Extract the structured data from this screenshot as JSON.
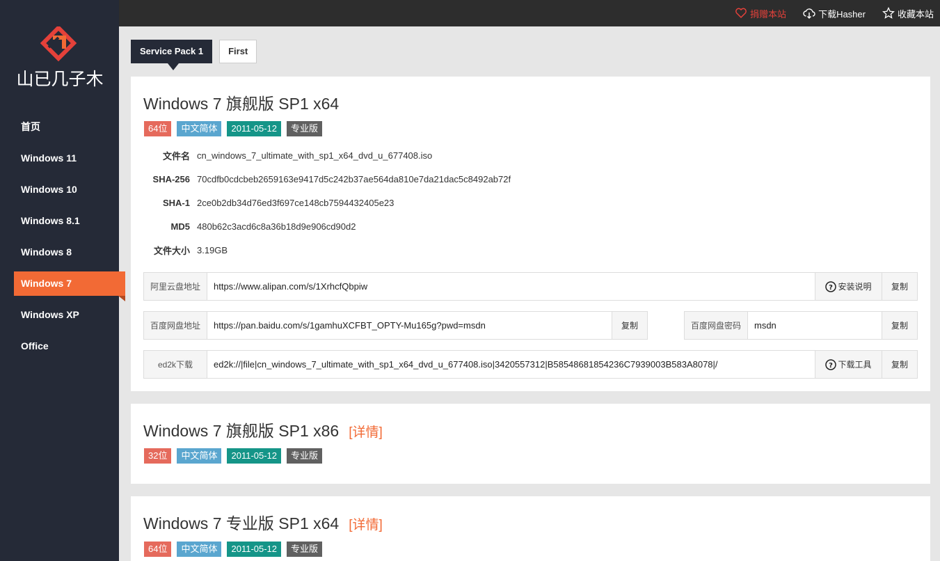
{
  "brand": {
    "logo_text": "山已几子木"
  },
  "nav": {
    "items": [
      {
        "label": "首页"
      },
      {
        "label": "Windows 11"
      },
      {
        "label": "Windows 10"
      },
      {
        "label": "Windows 8.1"
      },
      {
        "label": "Windows 8"
      },
      {
        "label": "Windows 7",
        "active": true
      },
      {
        "label": "Windows XP"
      },
      {
        "label": "Office"
      }
    ]
  },
  "topbar": {
    "donate": "捐赠本站",
    "download_hasher": "下载Hasher",
    "bookmark": "收藏本站"
  },
  "tabs": [
    {
      "label": "Service Pack 1",
      "active": true
    },
    {
      "label": "First"
    }
  ],
  "cards": [
    {
      "title": "Windows 7 旗舰版 SP1 x64",
      "badges": [
        "64位",
        "中文简体",
        "2011-05-12",
        "专业版"
      ],
      "info": [
        {
          "label": "文件名",
          "value": "cn_windows_7_ultimate_with_sp1_x64_dvd_u_677408.iso"
        },
        {
          "label": "SHA-256",
          "value": "70cdfb0cdcbeb2659163e9417d5c242b37ae564da810e7da21dac5c8492ab72f"
        },
        {
          "label": "SHA-1",
          "value": "2ce0b2db34d76ed3f697ce148cb7594432405e23"
        },
        {
          "label": "MD5",
          "value": "480b62c3acd6c8a36b18d9e906cd90d2"
        },
        {
          "label": "文件大小",
          "value": "3.19GB"
        }
      ],
      "aliyun": {
        "label": "阿里云盘地址",
        "value": "https://www.alipan.com/s/1XrhcfQbpiw",
        "help": "安装说明",
        "copy": "复制"
      },
      "baidu": {
        "label": "百度网盘地址",
        "value": "https://pan.baidu.com/s/1gamhuXCFBT_OPTY-Mu165g?pwd=msdn",
        "copy": "复制"
      },
      "baidu_pwd": {
        "label": "百度网盘密码",
        "value": "msdn",
        "copy": "复制"
      },
      "ed2k": {
        "label": "ed2k下载",
        "value": "ed2k://|file|cn_windows_7_ultimate_with_sp1_x64_dvd_u_677408.iso|3420557312|B58548681854236C7939003B583A8078|/",
        "help": "下载工具",
        "copy": "复制"
      }
    },
    {
      "title": "Windows 7 旗舰版 SP1 x86",
      "detail": "[详情]",
      "badges": [
        "32位",
        "中文简体",
        "2011-05-12",
        "专业版"
      ]
    },
    {
      "title": "Windows 7 专业版 SP1 x64",
      "detail": "[详情]",
      "badges": [
        "64位",
        "中文简体",
        "2011-05-12",
        "专业版"
      ]
    }
  ],
  "colors": {
    "sidebar": "#252a37",
    "accent": "#f26a35",
    "badge_bits": "#e56a5c",
    "badge_lang": "#5aa6cf",
    "badge_date": "#159588",
    "badge_edition": "#606060"
  }
}
